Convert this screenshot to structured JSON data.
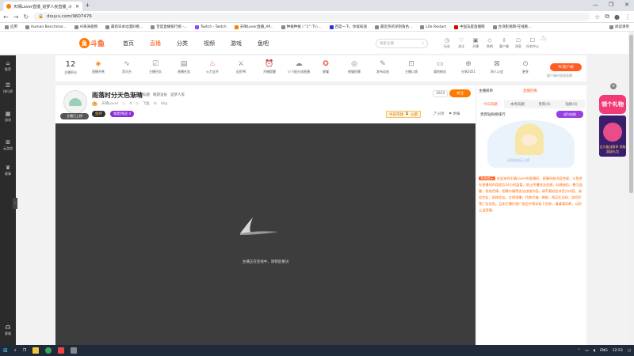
{
  "browser": {
    "tab_title": "天晴Lover直播_追梦人丧直播_斗",
    "url": "douyu.com/9607476",
    "bookmarks": [
      "应用",
      "Human Benchmar...",
      "AI海涛盘网",
      "最新日本动漫好看...",
      "百度直播排行榜 -...",
      "Twitch - Twitch",
      "天晴Lover直播_AP...",
      "种植种植丨“1”·下◇...",
      "百度一下，你就知道",
      "最近热的深刻角色...",
      "Life Restart",
      "中国法庭直播网",
      "台湾影视网-在线看...",
      "阅读清单"
    ]
  },
  "site": {
    "logo": "斗鱼",
    "nav": [
      "首页",
      "直播",
      "分类",
      "视频",
      "游戏",
      "鱼吧"
    ],
    "search_placeholder": "搜索主播",
    "header_icons": [
      {
        "label": "历史",
        "icon": "clock-icon"
      },
      {
        "label": "关注",
        "icon": "heart-icon"
      },
      {
        "label": "开播",
        "icon": "camera-icon"
      },
      {
        "label": "鱼吧",
        "icon": "fish-icon"
      },
      {
        "label": "客户端",
        "icon": "download-icon"
      },
      {
        "label": "消息",
        "icon": "bell-icon"
      },
      {
        "label": "任务中心",
        "icon": "task-icon"
      }
    ]
  },
  "left_sidebar": [
    {
      "label": "推荐",
      "icon": "home-icon"
    },
    {
      "label": "排行榜",
      "icon": "rank-icon"
    },
    {
      "label": "游戏",
      "icon": "game-icon"
    },
    {
      "label": "云游戏",
      "icon": "cloud-game-icon"
    },
    {
      "label": "赛事",
      "icon": "trophy-icon"
    },
    {
      "label": "客服",
      "icon": "headset-icon"
    }
  ],
  "categories": [
    {
      "label": "主播积分",
      "value": "12"
    },
    {
      "label": "直播开售",
      "icon": "bag-icon"
    },
    {
      "label": "音乐台",
      "icon": "wave-icon"
    },
    {
      "label": "主播任务",
      "icon": "task-icon"
    },
    {
      "label": "直播任务",
      "icon": "ab-icon"
    },
    {
      "label": "火力全开",
      "icon": "fire-icon"
    },
    {
      "label": "全民PK",
      "icon": "pk-icon"
    },
    {
      "label": "开播提醒",
      "icon": "alarm-icon"
    },
    {
      "label": "小飞船分流直播",
      "icon": "ship-icon"
    },
    {
      "label": "星耀",
      "icon": "star-icon"
    },
    {
      "label": "夜猫招募",
      "icon": "cat-icon"
    },
    {
      "label": "发布动态",
      "icon": "edit-icon"
    },
    {
      "label": "主播口袋",
      "icon": "pocket-icon"
    },
    {
      "label": "我的粉丝",
      "icon": "chat-icon"
    },
    {
      "label": "分享2021",
      "icon": "share-icon"
    },
    {
      "label": "四人公会",
      "icon": "guild-icon"
    },
    {
      "label": "更多",
      "icon": "more-icon"
    }
  ],
  "pc_client": {
    "button": "PC客户端",
    "sub": "客户端的超清直播"
  },
  "room": {
    "avatar_tag": "主播已上榜",
    "title": "雨落时分天色渐晴",
    "type": [
      "标题",
      "网游竞技",
      "追梦人丧"
    ],
    "level": "5",
    "owner": "天晴Lover",
    "hot": "4",
    "fish": "飞鱼",
    "weight": "4kg",
    "badge1": "鱼吧",
    "badge2": "福星挑战 4",
    "hot_rank": "3925",
    "follow": "关注",
    "rank_label": "今日可领",
    "rank_num": "1",
    "rank_suffix": "火箭",
    "share": "分享",
    "report": "举报"
  },
  "player": {
    "offline_message": "主播正在连线中，请稍后重试"
  },
  "right_panel": {
    "top_left": "主播榜单",
    "top_right": "直播回看",
    "tabs": [
      "今日贡献",
      "本周贡献",
      "贵宾(0)",
      "钻粉(0)"
    ],
    "active_tab": 0,
    "sub_label": "贵宾钻粉榜排行",
    "sub_button": "成为钻粉",
    "empty_text": "还没有钻石上榜",
    "notice_tag": "系统提示",
    "notice": "欢迎来到天晴Lover的直播间，直播间若内容违规，斗鱼将在直播间内用语言24小时监管。禁止传播违法违规、封建迷信、暴力血腥、低俗色情、招聘诈骗等违法违规内容。请不要轻信非官方内容，诚信交友，网络交友，文明观播，代练代抽、刷粉、购买礼包码、游戏币等广告信息。且如主播在推广商品中诱导私下交易，请谨慎判断，以防上当受骗。"
  },
  "gift": {
    "title": "领个礼物",
    "sub": "全力备战赛季 领取超级礼包"
  },
  "taskbar": {
    "lang": "ENG",
    "time": "12:53"
  }
}
